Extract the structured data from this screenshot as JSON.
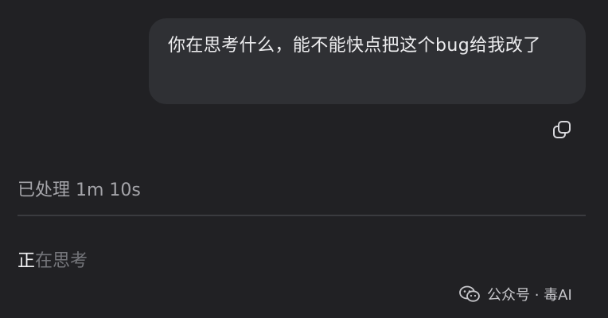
{
  "message": {
    "user_text": "你在思考什么，能不能快点把这个bug给我改了"
  },
  "actions": {
    "copy_icon": "copy-icon"
  },
  "process": {
    "label": "已处理 1m 10s"
  },
  "status": {
    "thinking_first_char": "正",
    "thinking_rest": "在思考"
  },
  "watermark": {
    "icon": "wechat-icon",
    "text": "公众号 · 毒AI"
  },
  "colors": {
    "background": "#212124",
    "bubble": "#2f3034",
    "divider": "#3a3b3f",
    "muted_text": "#a4a4a9",
    "dim_text": "#75767b"
  }
}
